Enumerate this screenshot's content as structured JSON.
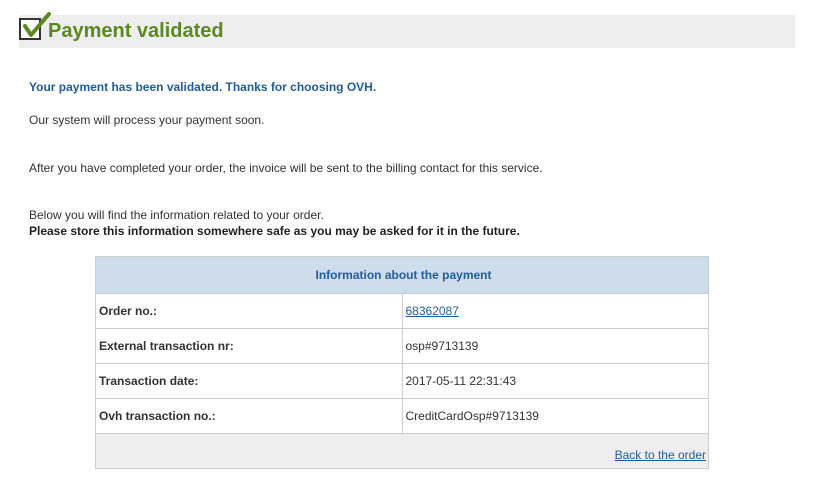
{
  "header": {
    "title": "Payment validated",
    "icon": "checkmark-icon",
    "title_color": "#5a8a1e"
  },
  "messages": {
    "validated": "Your payment has been validated. Thanks for choosing OVH.",
    "process": "Our system will process your payment soon.",
    "invoice": "After you have completed your order, the invoice will be sent to the billing contact for this service.",
    "below": "Below you will find the information related to your order.",
    "store": "Please store this information somewhere safe as you may be asked for it in the future."
  },
  "payment_table": {
    "heading": "Information about the payment",
    "rows": [
      {
        "label": "Order no.:",
        "value": "68362087"
      },
      {
        "label": "External transaction nr:",
        "value": "osp#9713139"
      },
      {
        "label": "Transaction date:",
        "value": "2017-05-11 22:31:43"
      },
      {
        "label": "Ovh transaction no.:",
        "value": "CreditCardOsp#9713139"
      }
    ],
    "back_link": "Back to the order"
  },
  "colors": {
    "accent_blue": "#1e5ea0",
    "header_bg": "#cfdcec",
    "title_bar_bg": "#eeeeee"
  }
}
